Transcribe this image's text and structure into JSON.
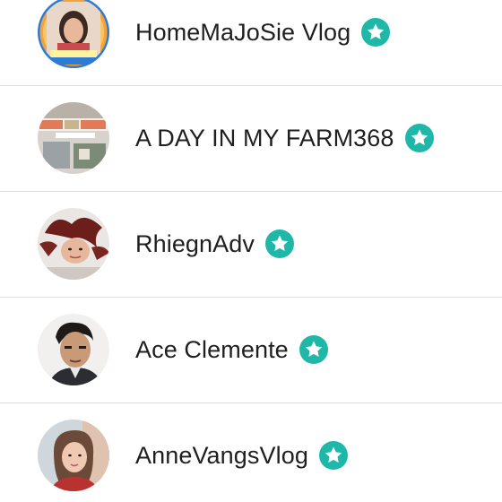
{
  "accent_color": "#1fb8a8",
  "items": [
    {
      "name": "HomeMaJoSie Vlog",
      "badge_icon": "star-badge-icon",
      "avatar": "avatar-homemajosie"
    },
    {
      "name": "A DAY IN MY FARM368",
      "badge_icon": "star-badge-icon",
      "avatar": "avatar-a-day-in-my-farm"
    },
    {
      "name": "RhiegnAdv",
      "badge_icon": "star-badge-icon",
      "avatar": "avatar-rhiegnadv"
    },
    {
      "name": "Ace Clemente",
      "badge_icon": "star-badge-icon",
      "avatar": "avatar-ace-clemente"
    },
    {
      "name": "AnneVangsVlog",
      "badge_icon": "star-badge-icon",
      "avatar": "avatar-annevangsvlog"
    }
  ]
}
